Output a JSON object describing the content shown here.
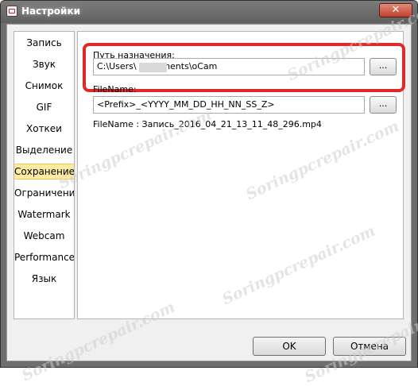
{
  "window": {
    "title": "Настройки",
    "close_glyph": "✕"
  },
  "sidebar": {
    "items": [
      {
        "label": "Запись"
      },
      {
        "label": "Звук"
      },
      {
        "label": "Снимок"
      },
      {
        "label": "GIF"
      },
      {
        "label": "Хоткеи"
      },
      {
        "label": "Выделение"
      },
      {
        "label": "Сохранение",
        "active": true
      },
      {
        "label": "Ограничение"
      },
      {
        "label": "Watermark"
      },
      {
        "label": "Webcam"
      },
      {
        "label": "Performance"
      },
      {
        "label": "Язык"
      }
    ]
  },
  "panel": {
    "dest_label": "Путь назначения:",
    "dest_value": "C:\\Users\\       Documents\\oCam",
    "browse_label": "...",
    "filename_label": "FileName:",
    "filename_value": "<Prefix>_<YYYY_MM_DD_HH_NN_SS_Z>",
    "filename_preview": "FileName : Запись_2016_04_21_13_11_48_296.mp4"
  },
  "footer": {
    "ok_label": "OK",
    "cancel_label": "Отмена"
  },
  "watermark_text": "Soringpcrepair.com",
  "colors": {
    "highlight": "#e02a2a",
    "active_item": "#fdeaa3"
  }
}
